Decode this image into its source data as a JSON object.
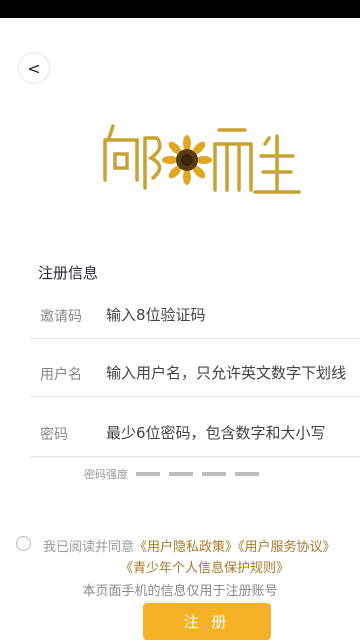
{
  "header": {
    "back_icon": "<"
  },
  "logo": {
    "text": "向阳而生"
  },
  "form": {
    "title": "注册信息",
    "invite": {
      "label": "邀请码",
      "placeholder": "输入8位验证码"
    },
    "username": {
      "label": "用户名",
      "placeholder": "输入用户名，只允许英文数字下划线"
    },
    "password": {
      "label": "密码",
      "placeholder": "最少6位密码，包含数字和大小写"
    },
    "strength_label": "密码强度"
  },
  "agreement": {
    "prefix": "我已阅读并同意",
    "privacy": "《用户隐私政策》",
    "service": "《用户服务协议》",
    "youth": "《青少年个人信息保护规则》"
  },
  "notice": "本页面手机的信息仅用于注册账号",
  "register_label": "注 册",
  "colors": {
    "accent": "#f6b227",
    "link": "#a7792a",
    "logo": "#c9a234"
  }
}
